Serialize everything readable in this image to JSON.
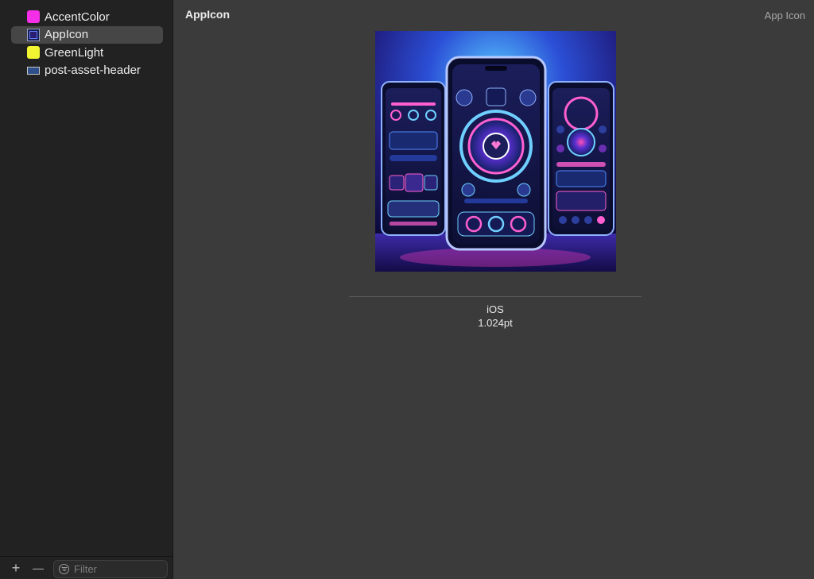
{
  "sidebar": {
    "items": [
      {
        "label": "AccentColor",
        "thumb": "color-swatch",
        "color": "#f52ee8"
      },
      {
        "label": "AppIcon",
        "thumb": "appicon-thumb",
        "selected": true
      },
      {
        "label": "GreenLight",
        "thumb": "color-swatch",
        "color": "#f2f531"
      },
      {
        "label": "post-asset-header",
        "thumb": "image-thumb"
      }
    ],
    "footer": {
      "add_label": "+",
      "remove_label": "—",
      "filter_placeholder": "Filter",
      "filter_icon": "filter-icon"
    }
  },
  "main": {
    "title": "AppIcon",
    "kind": "App Icon",
    "slot": {
      "platform": "iOS",
      "size": "1.024pt"
    }
  },
  "colors": {
    "sidebar_bg": "#222222",
    "main_bg": "#3b3b3b",
    "selection": "#464646"
  }
}
